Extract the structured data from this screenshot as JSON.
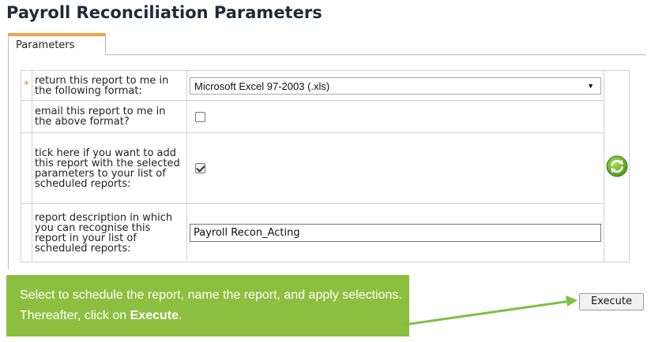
{
  "page": {
    "title": "Payroll Reconciliation Parameters"
  },
  "tabs": [
    {
      "label": "Parameters",
      "active": true
    }
  ],
  "params": {
    "required_marker": "*",
    "format": {
      "label": "return this report to me in the following format:",
      "value": "Microsoft Excel 97-2003 (.xls)",
      "arrow": "▼"
    },
    "email": {
      "label": "email this report to me in the above format?",
      "checked": false
    },
    "schedule": {
      "label": "tick here if you want to add this report with the selected parameters to your list of scheduled reports:",
      "checked": true
    },
    "description": {
      "label": "report description in which you can recognise this report in your list of scheduled reports:",
      "value": "Payroll Recon_Acting"
    }
  },
  "refresh_icon": {
    "name": "refresh-icon",
    "color": "#6fb52c"
  },
  "callout": {
    "text_before": "Select to schedule the report, name the report, and apply selections.  Thereafter, click on ",
    "text_bold": "Execute",
    "text_after": ".",
    "color": "#8cbf3f"
  },
  "execute": {
    "label": "Execute"
  },
  "colors": {
    "tab_accent": "#f5a04a",
    "title": "#1f2a3a",
    "required": "#e08a2a"
  }
}
